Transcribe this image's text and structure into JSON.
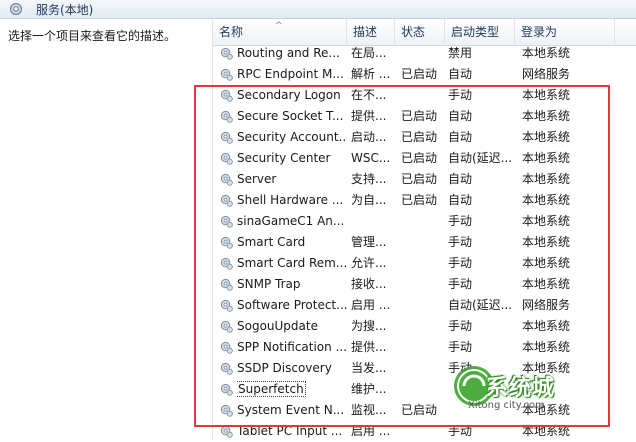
{
  "window": {
    "title": "服务(本地)"
  },
  "left_pane": {
    "description_prompt": "选择一个项目来查看它的描述。"
  },
  "columns": {
    "name": "名称",
    "desc": "描述",
    "status": "状态",
    "startup": "启动类型",
    "logon": "登录为"
  },
  "rows": [
    {
      "name": "Routing and Re...",
      "desc": "在局...",
      "status": "",
      "startup": "禁用",
      "logon": "本地系统"
    },
    {
      "name": "RPC Endpoint M...",
      "desc": "解析 ...",
      "status": "已启动",
      "startup": "自动",
      "logon": "网络服务"
    },
    {
      "name": "Secondary Logon",
      "desc": "在不...",
      "status": "",
      "startup": "手动",
      "logon": "本地系统"
    },
    {
      "name": "Secure Socket T...",
      "desc": "提供...",
      "status": "已启动",
      "startup": "自动",
      "logon": "本地系统"
    },
    {
      "name": "Security Account...",
      "desc": "启动...",
      "status": "已启动",
      "startup": "自动",
      "logon": "本地系统"
    },
    {
      "name": "Security Center",
      "desc": "WSC...",
      "status": "已启动",
      "startup": "自动(延迟...",
      "logon": "本地系统"
    },
    {
      "name": "Server",
      "desc": "支持...",
      "status": "已启动",
      "startup": "自动",
      "logon": "本地系统"
    },
    {
      "name": "Shell Hardware ...",
      "desc": "为自...",
      "status": "已启动",
      "startup": "自动",
      "logon": "本地系统"
    },
    {
      "name": "sinaGameC1 An...",
      "desc": "",
      "status": "",
      "startup": "手动",
      "logon": "本地系统"
    },
    {
      "name": "Smart Card",
      "desc": "管理...",
      "status": "",
      "startup": "手动",
      "logon": "本地系统"
    },
    {
      "name": "Smart Card Rem...",
      "desc": "允许...",
      "status": "",
      "startup": "手动",
      "logon": "本地系统"
    },
    {
      "name": "SNMP Trap",
      "desc": "接收...",
      "status": "",
      "startup": "手动",
      "logon": "本地系统"
    },
    {
      "name": "Software Protect...",
      "desc": "启用 ...",
      "status": "",
      "startup": "自动(延迟...",
      "logon": "网络服务"
    },
    {
      "name": "SogouUpdate",
      "desc": "为搜...",
      "status": "",
      "startup": "手动",
      "logon": "本地系统"
    },
    {
      "name": "SPP Notification ...",
      "desc": "提供...",
      "status": "",
      "startup": "手动",
      "logon": "本地系统"
    },
    {
      "name": "SSDP Discovery",
      "desc": "当发...",
      "status": "",
      "startup": "手动",
      "logon": "本地系统"
    },
    {
      "name": "Superfetch",
      "desc": "维护...",
      "status": "",
      "startup": "",
      "logon": ""
    },
    {
      "name": "System Event N...",
      "desc": "监视...",
      "status": "已启动",
      "startup": "",
      "logon": "本地系统"
    },
    {
      "name": "Tablet PC Input ...",
      "desc": "启用 ...",
      "status": "",
      "startup": "手动",
      "logon": "本地系统"
    }
  ],
  "watermark": {
    "brand": "系统城",
    "domain": "Xitong city.com"
  },
  "colors": {
    "highlight_box": "#e0383c",
    "header_text": "#1e395b",
    "watermark_green": "#3aa52a"
  },
  "icons": {
    "row_icon": "gear-icon",
    "title_icon": "gear-icon"
  }
}
